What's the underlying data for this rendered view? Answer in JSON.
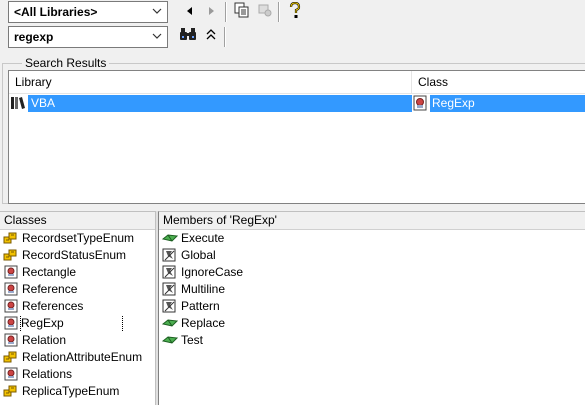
{
  "toolbar": {
    "library_combo": "<All Libraries>",
    "search_combo": "regexp",
    "icons": [
      "back-icon",
      "forward-icon",
      "copy-icon",
      "view-definition-icon",
      "help-icon",
      "binoculars-icon",
      "collapse-icon"
    ]
  },
  "search_results": {
    "legend": "Search Results",
    "columns": [
      "Library",
      "Class"
    ],
    "rows": [
      {
        "library": "VBA",
        "class": "RegExp"
      }
    ]
  },
  "classes": {
    "title": "Classes",
    "items": [
      {
        "label": "RecordsetTypeEnum",
        "icon": "enum-icon"
      },
      {
        "label": "RecordStatusEnum",
        "icon": "enum-icon"
      },
      {
        "label": "Rectangle",
        "icon": "class-icon"
      },
      {
        "label": "Reference",
        "icon": "class-icon"
      },
      {
        "label": "References",
        "icon": "class-icon"
      },
      {
        "label": "RegExp",
        "icon": "class-icon"
      },
      {
        "label": "Relation",
        "icon": "class-icon"
      },
      {
        "label": "RelationAttributeEnum",
        "icon": "enum-icon"
      },
      {
        "label": "Relations",
        "icon": "class-icon"
      },
      {
        "label": "ReplicaTypeEnum",
        "icon": "enum-icon"
      }
    ]
  },
  "members": {
    "title": "Members of 'RegExp'",
    "items": [
      {
        "label": "Execute",
        "icon": "method-icon"
      },
      {
        "label": "Global",
        "icon": "property-icon"
      },
      {
        "label": "IgnoreCase",
        "icon": "property-icon"
      },
      {
        "label": "Multiline",
        "icon": "property-icon"
      },
      {
        "label": "Pattern",
        "icon": "property-icon"
      },
      {
        "label": "Replace",
        "icon": "method-icon"
      },
      {
        "label": "Test",
        "icon": "method-icon"
      }
    ]
  }
}
